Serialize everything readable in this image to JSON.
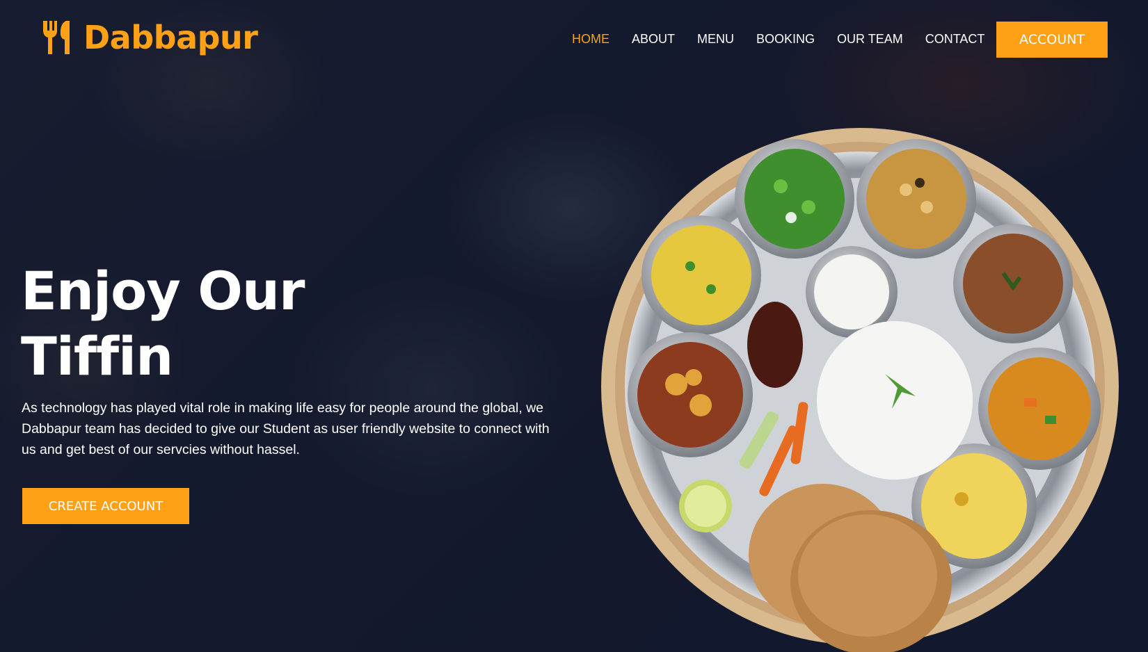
{
  "brand": {
    "name": "Dabbapur",
    "icon": "utensils-icon"
  },
  "nav": {
    "items": [
      {
        "label": "HOME",
        "active": true
      },
      {
        "label": "ABOUT",
        "active": false
      },
      {
        "label": "MENU",
        "active": false
      },
      {
        "label": "BOOKING",
        "active": false
      },
      {
        "label": "OUR TEAM",
        "active": false
      },
      {
        "label": "CONTACT",
        "active": false
      }
    ],
    "account_label": "ACCOUNT"
  },
  "hero": {
    "title_line1": "Enjoy Our",
    "title_line2": "Tiffin",
    "description": "As technology has played vital role in making life easy for people around the global, we Dabbapur team has decided to give our Student as user friendly website to connect with us and get best of our servcies without hassel.",
    "cta_label": "CREATE ACCOUNT"
  },
  "colors": {
    "accent": "#fea116",
    "background": "#0f172b",
    "text": "#ffffff"
  }
}
